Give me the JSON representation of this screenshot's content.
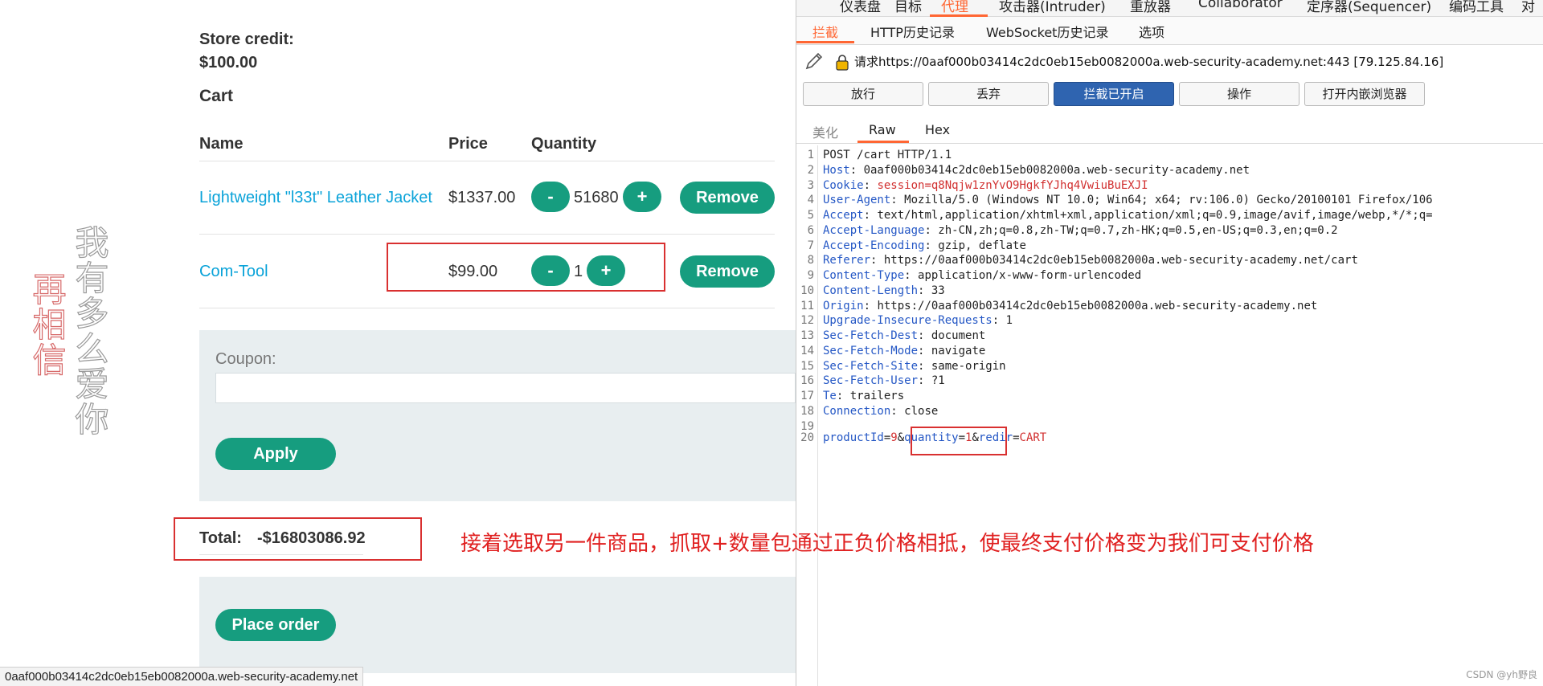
{
  "watermark": {
    "column1": "我有多么爱你",
    "column2": "再相信"
  },
  "shop": {
    "store_credit_label": "Store credit:",
    "store_credit_value": "$100.00",
    "cart_title": "Cart",
    "headers": {
      "name": "Name",
      "price": "Price",
      "quantity": "Quantity"
    },
    "rows": [
      {
        "name": "Lightweight \"l33t\" Leather Jacket",
        "price": "$1337.00",
        "quantity": "51680",
        "minus": "-",
        "plus": "+",
        "remove": "Remove"
      },
      {
        "name": "Com-Tool",
        "price": "$99.00",
        "quantity": "1",
        "minus": "-",
        "plus": "+",
        "remove": "Remove"
      }
    ],
    "coupon_label": "Coupon:",
    "coupon_value": "",
    "apply": "Apply",
    "total_label": "Total:",
    "total_value": "-$16803086.92",
    "place_order": "Place order",
    "status_url": "0aaf000b03414c2dc0eb15eb0082000a.web-security-academy.net"
  },
  "annotation": "接着选取另一件商品，抓取+数量包通过正负价格相抵，使最终支付价格变为我们可支付价格",
  "burp": {
    "top_tabs": [
      "仪表盘",
      "目标",
      "代理",
      "攻击器(Intruder)",
      "重放器",
      "Collaborator",
      "定序器(Sequencer)",
      "编码工具",
      "对"
    ],
    "sub_tabs": [
      "拦截",
      "HTTP历史记录",
      "WebSocket历史记录",
      "选项"
    ],
    "request_line": "请求https://0aaf000b03414c2dc0eb15eb0082000a.web-security-academy.net:443  [79.125.84.16]",
    "buttons": [
      "放行",
      "丢弃",
      "拦截已开启",
      "操作",
      "打开内嵌浏览器"
    ],
    "view_tabs": [
      "美化",
      "Raw",
      "Hex"
    ],
    "lines": [
      {
        "n": "1",
        "key": "",
        "sep": "",
        "val": "POST /cart HTTP/1.1"
      },
      {
        "n": "2",
        "key": "Host",
        "sep": ": ",
        "val": "0aaf000b03414c2dc0eb15eb0082000a.web-security-academy.net"
      },
      {
        "n": "3",
        "key": "Cookie",
        "sep": ": ",
        "val": "session=q8Nqjw1znYvO9HgkfYJhq4VwiuBuEXJI"
      },
      {
        "n": "4",
        "key": "User-Agent",
        "sep": ": ",
        "val": "Mozilla/5.0 (Windows NT 10.0; Win64; x64; rv:106.0) Gecko/20100101 Firefox/106"
      },
      {
        "n": "5",
        "key": "Accept",
        "sep": ": ",
        "val": "text/html,application/xhtml+xml,application/xml;q=0.9,image/avif,image/webp,*/*;q="
      },
      {
        "n": "6",
        "key": "Accept-Language",
        "sep": ": ",
        "val": "zh-CN,zh;q=0.8,zh-TW;q=0.7,zh-HK;q=0.5,en-US;q=0.3,en;q=0.2"
      },
      {
        "n": "7",
        "key": "Accept-Encoding",
        "sep": ": ",
        "val": "gzip, deflate"
      },
      {
        "n": "8",
        "key": "Referer",
        "sep": ": ",
        "val": "https://0aaf000b03414c2dc0eb15eb0082000a.web-security-academy.net/cart"
      },
      {
        "n": "9",
        "key": "Content-Type",
        "sep": ": ",
        "val": "application/x-www-form-urlencoded"
      },
      {
        "n": "10",
        "key": "Content-Length",
        "sep": ": ",
        "val": "33"
      },
      {
        "n": "11",
        "key": "Origin",
        "sep": ": ",
        "val": "https://0aaf000b03414c2dc0eb15eb0082000a.web-security-academy.net"
      },
      {
        "n": "12",
        "key": "Upgrade-Insecure-Requests",
        "sep": ": ",
        "val": "1"
      },
      {
        "n": "13",
        "key": "Sec-Fetch-Dest",
        "sep": ": ",
        "val": "document"
      },
      {
        "n": "14",
        "key": "Sec-Fetch-Mode",
        "sep": ": ",
        "val": "navigate"
      },
      {
        "n": "15",
        "key": "Sec-Fetch-Site",
        "sep": ": ",
        "val": "same-origin"
      },
      {
        "n": "16",
        "key": "Sec-Fetch-User",
        "sep": ": ",
        "val": "?1"
      },
      {
        "n": "17",
        "key": "Te",
        "sep": ": ",
        "val": "trailers"
      },
      {
        "n": "18",
        "key": "Connection",
        "sep": ": ",
        "val": "close"
      },
      {
        "n": "19",
        "key": "",
        "sep": "",
        "val": ""
      }
    ],
    "body_line": {
      "n": "20",
      "k1": "productId",
      "eq1": "=",
      "v1": "9",
      "amp1": "&",
      "k2": "quantity",
      "eq2": "=",
      "v2": "1",
      "amp2": "&",
      "k3": "redir",
      "eq3": "=",
      "v3": "CART"
    },
    "watermark_csdn": "CSDN @yh野良"
  },
  "colors": {
    "accent_green": "#169d7f",
    "link_blue": "#0aa3d9",
    "burp_orange": "#ff6633",
    "highlight_red": "#d93030"
  }
}
